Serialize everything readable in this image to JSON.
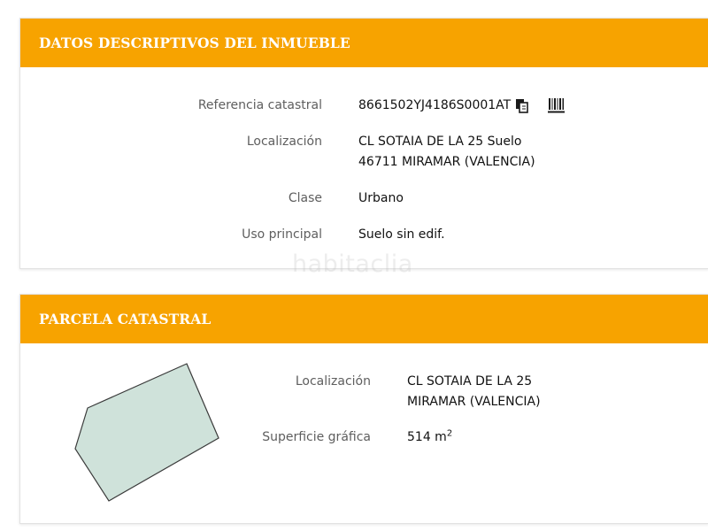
{
  "property": {
    "title": "DATOS DESCRIPTIVOS DEL INMUEBLE",
    "referencia_label": "Referencia catastral",
    "referencia_value": "8661502YJ4186S0001AT",
    "localizacion_label": "Localización",
    "localizacion_line1": "CL SOTAIA DE LA 25 Suelo",
    "localizacion_line2": "46711 MIRAMAR (VALENCIA)",
    "clase_label": "Clase",
    "clase_value": "Urbano",
    "uso_label": "Uso principal",
    "uso_value": "Suelo sin edif."
  },
  "parcel": {
    "title": "PARCELA CATASTRAL",
    "localizacion_label": "Localización",
    "localizacion_line1": "CL SOTAIA DE LA 25",
    "localizacion_line2": "MIRAMAR (VALENCIA)",
    "superficie_label": "Superficie gráfica",
    "superficie_value": "514 m",
    "superficie_unit_exp": "2"
  },
  "icons": {
    "copy": "copy-icon",
    "barcode": "barcode-icon"
  },
  "watermark": "habitaclia",
  "colors": {
    "header_bg": "#f7a300",
    "header_text": "#ffffff",
    "parcel_fill": "#cfe2da",
    "parcel_stroke": "#3a3a3a"
  }
}
